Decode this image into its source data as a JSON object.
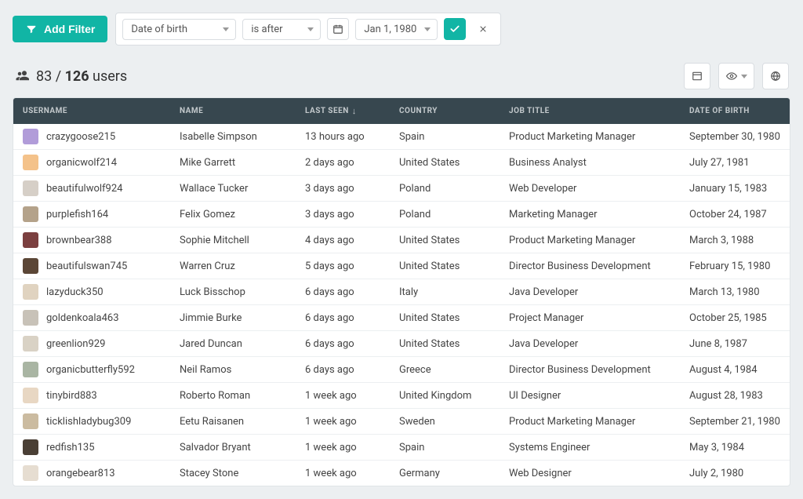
{
  "filterBar": {
    "addFilterLabel": "Add Filter",
    "fieldSelect": "Date of birth",
    "operatorSelect": "is after",
    "dateValue": "Jan 1, 1980"
  },
  "countBar": {
    "filtered": "83",
    "separator": " / ",
    "total": "126",
    "label": " users"
  },
  "columns": {
    "username": "USERNAME",
    "name": "NAME",
    "lastSeen": "LAST SEEN",
    "lastSeenSort": "↓",
    "country": "COUNTRY",
    "jobTitle": "JOB TITLE",
    "dob": "DATE OF BIRTH"
  },
  "rows": [
    {
      "username": "crazygoose215",
      "name": "Isabelle Simpson",
      "lastSeen": "13 hours ago",
      "country": "Spain",
      "jobTitle": "Product Marketing Manager",
      "dob": "September 30, 1980"
    },
    {
      "username": "organicwolf214",
      "name": "Mike Garrett",
      "lastSeen": "2 days ago",
      "country": "United States",
      "jobTitle": "Business Analyst",
      "dob": "July 27, 1981"
    },
    {
      "username": "beautifulwolf924",
      "name": "Wallace Tucker",
      "lastSeen": "3 days ago",
      "country": "Poland",
      "jobTitle": "Web Developer",
      "dob": "January 15, 1983"
    },
    {
      "username": "purplefish164",
      "name": "Felix Gomez",
      "lastSeen": "3 days ago",
      "country": "Poland",
      "jobTitle": "Marketing Manager",
      "dob": "October 24, 1987"
    },
    {
      "username": "brownbear388",
      "name": "Sophie Mitchell",
      "lastSeen": "4 days ago",
      "country": "United States",
      "jobTitle": "Product Marketing Manager",
      "dob": "March 3, 1988"
    },
    {
      "username": "beautifulswan745",
      "name": "Warren Cruz",
      "lastSeen": "5 days ago",
      "country": "United States",
      "jobTitle": "Director Business Development",
      "dob": "February 15, 1980"
    },
    {
      "username": "lazyduck350",
      "name": "Luck Bisschop",
      "lastSeen": "6 days ago",
      "country": "Italy",
      "jobTitle": "Java Developer",
      "dob": "March 13, 1980"
    },
    {
      "username": "goldenkoala463",
      "name": "Jimmie Burke",
      "lastSeen": "6 days ago",
      "country": "United States",
      "jobTitle": "Project Manager",
      "dob": "October 25, 1985"
    },
    {
      "username": "greenlion929",
      "name": "Jared Duncan",
      "lastSeen": "6 days ago",
      "country": "United States",
      "jobTitle": "Java Developer",
      "dob": "June 8, 1987"
    },
    {
      "username": "organicbutterfly592",
      "name": "Neil Ramos",
      "lastSeen": "6 days ago",
      "country": "Greece",
      "jobTitle": "Director Business Development",
      "dob": "August 4, 1984"
    },
    {
      "username": "tinybird883",
      "name": "Roberto Roman",
      "lastSeen": "1 week ago",
      "country": "United Kingdom",
      "jobTitle": "UI Designer",
      "dob": "August 28, 1983"
    },
    {
      "username": "ticklishladybug309",
      "name": "Eetu Raisanen",
      "lastSeen": "1 week ago",
      "country": "Sweden",
      "jobTitle": "Product Marketing Manager",
      "dob": "September 21, 1980"
    },
    {
      "username": "redfish135",
      "name": "Salvador Bryant",
      "lastSeen": "1 week ago",
      "country": "Spain",
      "jobTitle": "Systems Engineer",
      "dob": "May 3, 1984"
    },
    {
      "username": "orangebear813",
      "name": "Stacey Stone",
      "lastSeen": "1 week ago",
      "country": "Germany",
      "jobTitle": "Web Designer",
      "dob": "July 2, 1980"
    }
  ]
}
